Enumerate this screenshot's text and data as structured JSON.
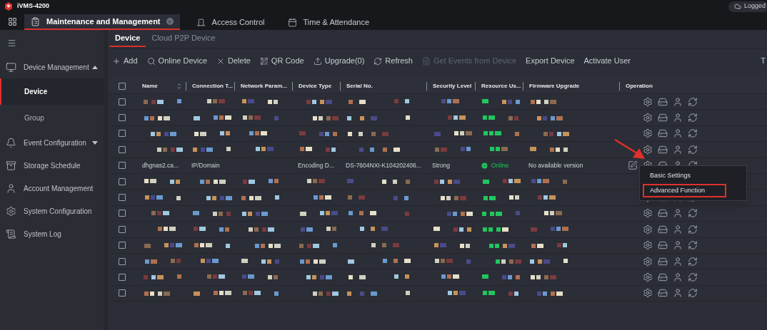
{
  "app": {
    "title": "iVMS-4200",
    "status": "Logged"
  },
  "top_tabs": [
    {
      "label": "Maintenance and Management",
      "selected": true,
      "closable": true
    },
    {
      "label": "Access Control",
      "selected": false,
      "closable": false
    },
    {
      "label": "Time & Attendance",
      "selected": false,
      "closable": false
    }
  ],
  "sidebar": {
    "items": [
      {
        "label": "Device Management",
        "expanded": true,
        "children": [
          {
            "label": "Device",
            "selected": true
          },
          {
            "label": "Group",
            "selected": false
          }
        ]
      },
      {
        "label": "Event Configuration",
        "expanded": false
      },
      {
        "label": "Storage Schedule"
      },
      {
        "label": "Account Management"
      },
      {
        "label": "System Configuration"
      },
      {
        "label": "System Log"
      }
    ]
  },
  "sub_tabs": [
    {
      "label": "Device",
      "selected": true
    },
    {
      "label": "Cloud P2P Device",
      "selected": false
    }
  ],
  "toolbar": {
    "buttons": [
      {
        "label": "Add",
        "disabled": false
      },
      {
        "label": "Online Device",
        "disabled": false
      },
      {
        "label": "Delete",
        "disabled": false
      },
      {
        "label": "QR Code",
        "disabled": false
      },
      {
        "label": "Upgrade(0)",
        "disabled": false
      },
      {
        "label": "Refresh",
        "disabled": false
      },
      {
        "label": "Get Events from Device",
        "disabled": true
      },
      {
        "label": "Export Device",
        "disabled": false
      },
      {
        "label": "Activate User",
        "disabled": false
      }
    ],
    "edge_text": "T"
  },
  "table": {
    "header_checked": false,
    "columns": [
      "Name",
      "Connection T...",
      "Network Param...",
      "Device Type",
      "Serial No.",
      "Security Level",
      "Resource Us...",
      "Firmware Upgrade",
      "Operation"
    ],
    "rows": [
      {
        "kind": "redacted",
        "checked": false
      },
      {
        "kind": "redacted",
        "checked": false
      },
      {
        "kind": "redacted",
        "checked": false
      },
      {
        "kind": "redacted",
        "checked": false
      },
      {
        "kind": "device",
        "checked": false,
        "name": "dhgnas2.ca...",
        "connection": "IP/Domain",
        "device_type": "Encoding D...",
        "serial": "DS-7604NXI-K104202406...",
        "security": "Strong",
        "status": "Online",
        "firmware": "No available version"
      },
      {
        "kind": "redacted",
        "checked": false
      },
      {
        "kind": "redacted",
        "checked": false
      },
      {
        "kind": "redacted",
        "checked": false
      },
      {
        "kind": "redacted",
        "checked": false
      },
      {
        "kind": "redacted",
        "checked": false
      },
      {
        "kind": "redacted",
        "checked": false
      },
      {
        "kind": "redacted",
        "checked": false
      },
      {
        "kind": "redacted",
        "checked": false
      }
    ]
  },
  "context_menu": {
    "items": [
      {
        "label": "Basic Settings",
        "highlighted": false
      },
      {
        "label": "Advanced Function",
        "highlighted": true
      }
    ]
  }
}
